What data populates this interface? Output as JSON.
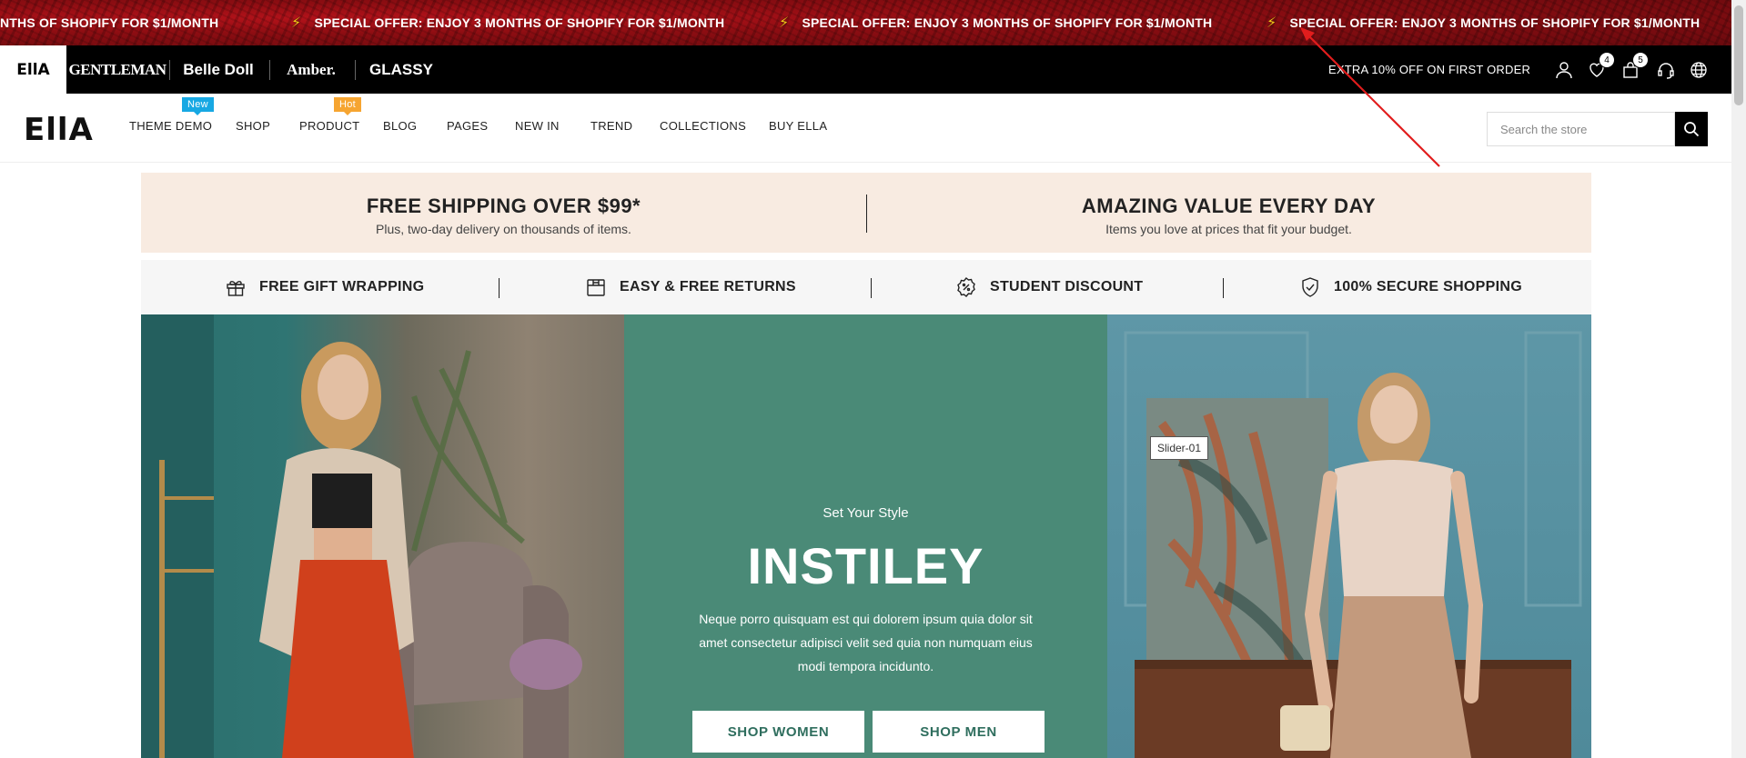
{
  "announcement": {
    "text": "SPECIAL OFFER: ENJOY 3 MONTHS OF SHOPIFY FOR $1/MONTH",
    "partial_text": "NTHS OF SHOPIFY FOR $1/MONTH"
  },
  "store_switcher": {
    "stores": [
      "EllA",
      "GENTLEMAN",
      "Belle Doll",
      "Amber.",
      "GLASSY"
    ],
    "extra_offer": "EXTRA 10% OFF ON FIRST ORDER",
    "wishlist_count": "4",
    "cart_count": "5"
  },
  "nav": {
    "logo": "EllA",
    "items": [
      {
        "label": "THEME DEMO",
        "tag": "New"
      },
      {
        "label": "SHOP",
        "tag": ""
      },
      {
        "label": "PRODUCT",
        "tag": "Hot"
      },
      {
        "label": "BLOG",
        "tag": ""
      },
      {
        "label": "PAGES",
        "tag": ""
      },
      {
        "label": "NEW IN",
        "tag": ""
      },
      {
        "label": "TREND",
        "tag": ""
      },
      {
        "label": "COLLECTIONS",
        "tag": ""
      },
      {
        "label": "BUY ELLA",
        "tag": ""
      }
    ],
    "search_placeholder": "Search the store"
  },
  "promo": {
    "left_title": "FREE SHIPPING OVER $99*",
    "left_sub": "Plus, two-day delivery on thousands of items.",
    "right_title": "AMAZING VALUE EVERY DAY",
    "right_sub": "Items you love at prices that fit your budget."
  },
  "features": [
    {
      "label": "FREE GIFT WRAPPING",
      "icon": "gift-icon"
    },
    {
      "label": "EASY & FREE RETURNS",
      "icon": "box-icon"
    },
    {
      "label": "STUDENT DISCOUNT",
      "icon": "percent-badge-icon"
    },
    {
      "label": "100% SECURE SHOPPING",
      "icon": "shield-check-icon"
    }
  ],
  "hero": {
    "kicker": "Set Your Style",
    "title": "INSTILEY",
    "description": "Neque porro quisquam est qui dolorem ipsum quia dolor sit amet consectetur adipisci velit sed quia non numquam eius modi tempora incidunto.",
    "button_women": "SHOP WOMEN",
    "button_men": "SHOP MEN",
    "slider_label": "Slider-01"
  },
  "colors": {
    "announcement_bg": "#8c0d12",
    "promo_bg": "#f8ebe1",
    "hero_center_bg": "#4a8a77",
    "tag_new": "#17a8e3",
    "tag_hot": "#f6a531",
    "annotation_arrow": "#e11d1d"
  }
}
